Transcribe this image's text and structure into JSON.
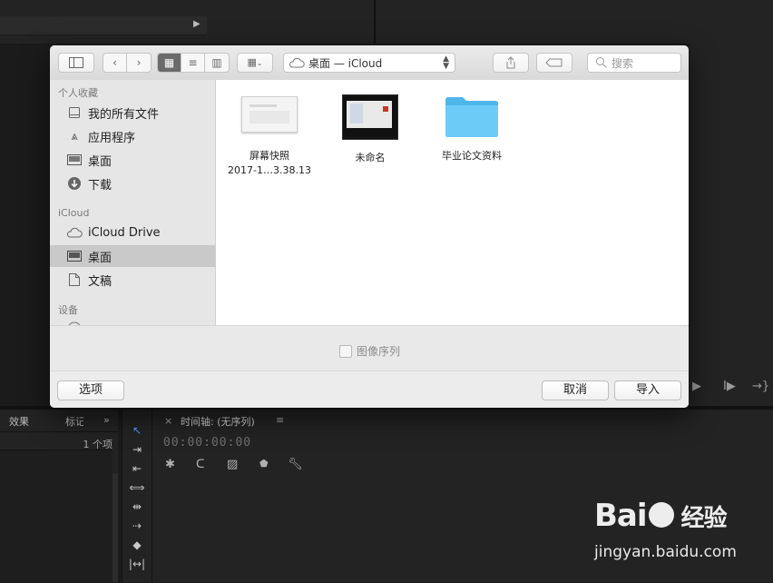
{
  "dialog": {
    "location": "桌面 — iCloud",
    "search_placeholder": "搜索",
    "sidebar": {
      "favorites_header": "个人收藏",
      "favorites": [
        {
          "label": "我的所有文件",
          "icon": "all-files-icon"
        },
        {
          "label": "应用程序",
          "icon": "applications-icon"
        },
        {
          "label": "桌面",
          "icon": "desktop-icon"
        },
        {
          "label": "下载",
          "icon": "downloads-icon"
        }
      ],
      "icloud_header": "iCloud",
      "icloud": [
        {
          "label": "iCloud Drive",
          "icon": "cloud-icon"
        },
        {
          "label": "桌面",
          "icon": "desktop-icon"
        },
        {
          "label": "文稿",
          "icon": "documents-icon"
        }
      ],
      "devices_header": "设备"
    },
    "files": [
      {
        "name": "屏幕快照",
        "sub": "2017-1…3.38.13"
      },
      {
        "name": "未命名",
        "sub": ""
      },
      {
        "name": "毕业论文资料",
        "sub": ""
      }
    ],
    "checkbox_label": "图像序列",
    "options_button": "选项",
    "cancel_button": "取消",
    "import_button": "导入"
  },
  "background": {
    "project_tabs": [
      "效果",
      "标记"
    ],
    "item_count": "1 个项",
    "timeline_title": "时间轴: (无序列)",
    "timecode": "00:00:00:00"
  },
  "watermark": {
    "logo": "Bai",
    "logo_tail": "经验",
    "url": "jingyan.baidu.com"
  },
  "colors": {
    "folder": "#5ec6f5",
    "selected_row": "#c9c9c9",
    "app_background": "#232323"
  }
}
